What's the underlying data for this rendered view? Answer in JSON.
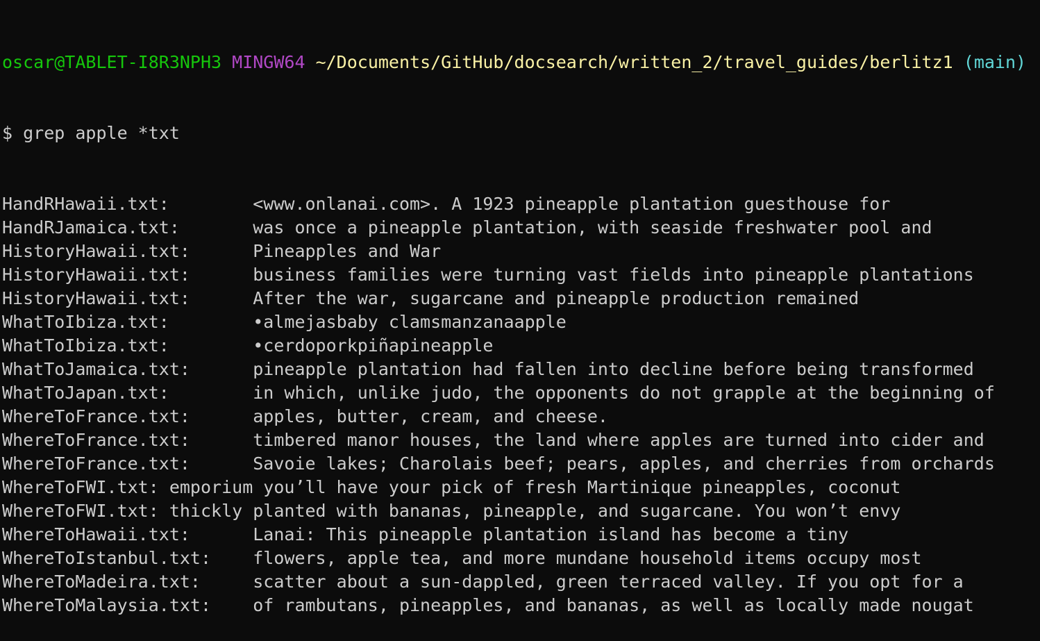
{
  "prompt": {
    "user_host": "oscar@TABLET-I8R3NPH3",
    "system": "MINGW64",
    "cwd": "~/Documents/GitHub/docsearch/written_2/travel_guides/berlitz1",
    "branch": "(main)",
    "colors": {
      "user_host": "#16c60c",
      "system": "#b148c6",
      "cwd": "#f9f1a5",
      "branch": "#61d6d6",
      "text": "#cccccc",
      "background": "#0c0c0c"
    }
  },
  "command": "$ grep apple *txt",
  "results": [
    {
      "file": "HandRHawaii.txt:",
      "match": "        <www.onlanai.com>. A 1923 pineapple plantation guesthouse for"
    },
    {
      "file": "HandRJamaica.txt:",
      "match": "        was once a pineapple plantation, with seaside freshwater pool and"
    },
    {
      "file": "HistoryHawaii.txt:",
      "match": "        Pineapples and War"
    },
    {
      "file": "HistoryHawaii.txt:",
      "match": "        business families were turning vast fields into pineapple plantations"
    },
    {
      "file": "HistoryHawaii.txt:",
      "match": "        After the war, sugarcane and pineapple production remained"
    },
    {
      "file": "WhatToIbiza.txt:",
      "match": "        •almejasbaby clamsmanzanaapple"
    },
    {
      "file": "WhatToIbiza.txt:",
      "match": "        •cerdoporkpiñapineapple"
    },
    {
      "file": "WhatToJamaica.txt:",
      "match": "        pineapple plantation had fallen into decline before being transformed"
    },
    {
      "file": "WhatToJapan.txt:",
      "match": "        in which, unlike judo, the opponents do not grapple at the beginning of"
    },
    {
      "file": "WhereToFrance.txt:",
      "match": "        apples, butter, cream, and cheese."
    },
    {
      "file": "WhereToFrance.txt:",
      "match": "        timbered manor houses, the land where apples are turned into cider and"
    },
    {
      "file": "WhereToFrance.txt:",
      "match": "        Savoie lakes; Charolais beef; pears, apples, and cherries from orchards"
    },
    {
      "file": "WhereToFWI.txt:",
      "match": "        emporium you’ll have your pick of fresh Martinique pineapples, coconut"
    },
    {
      "file": "WhereToFWI.txt:",
      "match": "        thickly planted with bananas, pineapple, and sugarcane. You won’t envy"
    },
    {
      "file": "WhereToHawaii.txt:",
      "match": "        Lanai: This pineapple plantation island has become a tiny"
    },
    {
      "file": "WhereToIstanbul.txt:",
      "match": "        flowers, apple tea, and more mundane household items occupy most"
    },
    {
      "file": "WhereToMadeira.txt:",
      "match": "        scatter about a sun-dappled, green terraced valley. If you opt for a"
    },
    {
      "file": "WhereToMalaysia.txt:",
      "match": "        of rambutans, pineapples, and bananas, as well as locally made nougat"
    }
  ]
}
